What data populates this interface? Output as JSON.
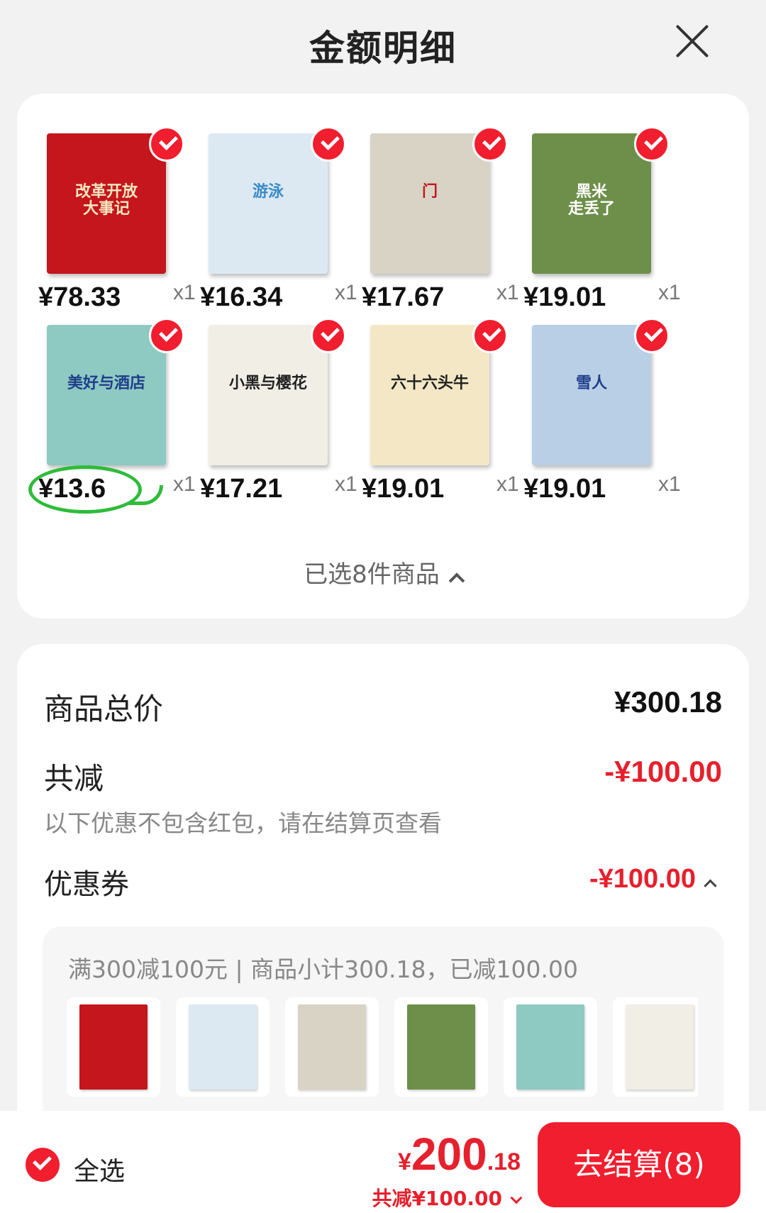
{
  "header": {
    "title": "金额明细"
  },
  "products": [
    {
      "price": "¥78.33",
      "qty": "x1",
      "cover_text": "改革开放\n大事记",
      "bg": "#c4161c",
      "fg": "#f6e7c0"
    },
    {
      "price": "¥16.34",
      "qty": "x1",
      "cover_text": "游泳",
      "bg": "#dce9f3",
      "fg": "#3a8bc4"
    },
    {
      "price": "¥17.67",
      "qty": "x1",
      "cover_text": "门",
      "bg": "#d9d3c6",
      "fg": "#c4161c"
    },
    {
      "price": "¥19.01",
      "qty": "x1",
      "cover_text": "黑米\n走丢了",
      "bg": "#6e8f4a",
      "fg": "#ffffff"
    },
    {
      "price": "¥13.6",
      "qty": "x1",
      "cover_text": "美好与酒店",
      "bg": "#8ec9c2",
      "fg": "#1f3e8a",
      "circled": true
    },
    {
      "price": "¥17.21",
      "qty": "x1",
      "cover_text": "小黑与樱花",
      "bg": "#f1eee6",
      "fg": "#222222"
    },
    {
      "price": "¥19.01",
      "qty": "x1",
      "cover_text": "六十六头牛",
      "bg": "#f3e7c5",
      "fg": "#222222"
    },
    {
      "price": "¥19.01",
      "qty": "x1",
      "cover_text": "雪人",
      "bg": "#b9cfe6",
      "fg": "#1f3e8a"
    }
  ],
  "selected_text": "已选8件商品",
  "summary": {
    "total_label": "商品总价",
    "total_value": "¥300.18",
    "discount_label": "共减",
    "discount_value": "-¥100.00",
    "note": "以下优惠不包含红包，请在结算页查看",
    "coupon_label": "优惠券",
    "coupon_value": "-¥100.00",
    "coupon_desc": "满300减100元 | 商品小计300.18，已减100.00"
  },
  "bottom": {
    "select_all": "全选",
    "currency": "¥",
    "total_int": "200",
    "total_dec": ".18",
    "discount": "共减¥100.00",
    "checkout": "去结算(8)"
  },
  "colors": {
    "accent": "#e6202d",
    "check": "#f01e2e",
    "annotation": "#2ebc3a"
  }
}
